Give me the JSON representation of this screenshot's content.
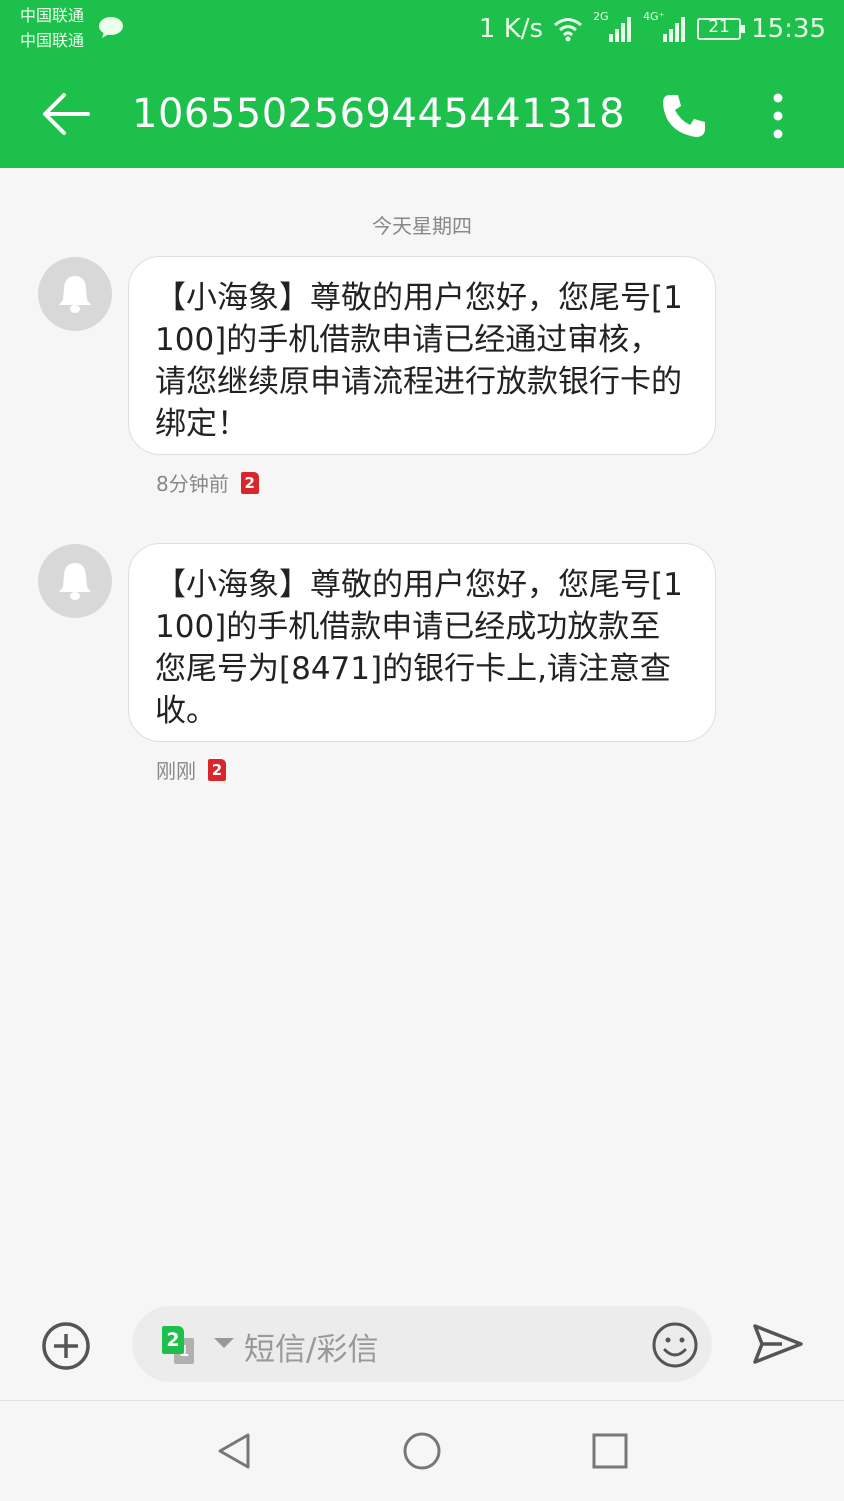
{
  "status_bar": {
    "carrier_1": "中国联通",
    "carrier_2": "中国联通",
    "speed": "1 K/s",
    "sim1_network": "2G",
    "sim2_network": "4G⁺",
    "battery": "21",
    "time": "15:35"
  },
  "header": {
    "title": "1065502569445441318",
    "back_icon": "arrow-left-icon",
    "call_icon": "phone-icon",
    "more_icon": "more-vertical-icon"
  },
  "conversation": {
    "date_separator": "今天星期四",
    "messages": [
      {
        "text": "【小海象】尊敬的用户您好，您尾号[1100]的手机借款申请已经通过审核，请您继续原申请流程进行放款银行卡的绑定！",
        "time": "8分钟前",
        "sim": "2"
      },
      {
        "text": "【小海象】尊敬的用户您好，您尾号[1100]的手机借款申请已经成功放款至您尾号为[8471]的银行卡上,请注意查收。",
        "time": "刚刚",
        "sim": "2"
      }
    ]
  },
  "composer": {
    "placeholder": "短信/彩信",
    "sim_selected": "2",
    "sim_other": "1"
  },
  "colors": {
    "accent": "#1ec04c",
    "sim_badge": "#d9252b",
    "bubble_bg": "#ffffff",
    "page_bg": "#f6f6f6"
  }
}
